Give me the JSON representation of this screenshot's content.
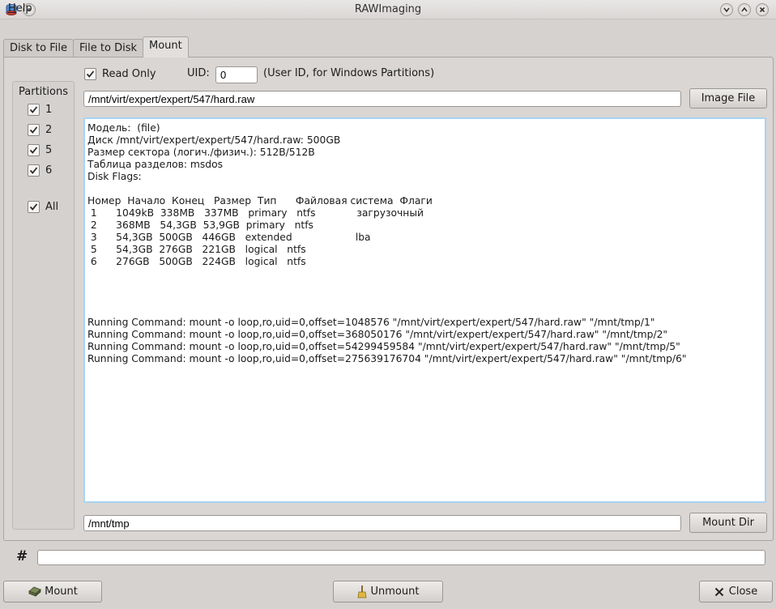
{
  "window": {
    "title": "RAWImaging"
  },
  "menu": {
    "help": "Help"
  },
  "tabs": [
    {
      "label": "Disk to File"
    },
    {
      "label": "File to Disk"
    },
    {
      "label": "Mount"
    }
  ],
  "mount": {
    "read_only_label": "Read Only",
    "read_only_checked": true,
    "uid_label": "UID:",
    "uid_value": "0",
    "uid_hint": "(User ID, for Windows Partitions)",
    "image_path": "/mnt/virt/expert/expert/547/hard.raw",
    "image_file_button": "Image File",
    "mount_dir": "/mnt/tmp",
    "mount_dir_button": "Mount Dir"
  },
  "partitions": {
    "title": "Partitions",
    "items": [
      {
        "label": "1",
        "checked": true
      },
      {
        "label": "2",
        "checked": true
      },
      {
        "label": "5",
        "checked": true
      },
      {
        "label": "6",
        "checked": true
      }
    ],
    "all": {
      "label": "All",
      "checked": true
    }
  },
  "output": {
    "text": "Модель:  (file)\nДиск /mnt/virt/expert/expert/547/hard.raw: 500GB\nРазмер сектора (логич./физич.): 512B/512B\nТаблица разделов: msdos\nDisk Flags:\n\nНомер  Начало  Конец   Размер  Тип      Файловая система  Флаги\n 1      1049kB  338MB   337MB   primary   ntfs             загрузочный\n 2      368MB   54,3GB  53,9GB  primary   ntfs\n 3      54,3GB  500GB   446GB   extended                    lba\n 5      54,3GB  276GB   221GB   logical   ntfs\n 6      276GB   500GB   224GB   logical   ntfs\n\n\n\n\nRunning Command: mount -o loop,ro,uid=0,offset=1048576 \"/mnt/virt/expert/expert/547/hard.raw\" \"/mnt/tmp/1\"\nRunning Command: mount -o loop,ro,uid=0,offset=368050176 \"/mnt/virt/expert/expert/547/hard.raw\" \"/mnt/tmp/2\"\nRunning Command: mount -o loop,ro,uid=0,offset=54299459584 \"/mnt/virt/expert/expert/547/hard.raw\" \"/mnt/tmp/5\"\nRunning Command: mount -o loop,ro,uid=0,offset=275639176704 \"/mnt/virt/expert/expert/547/hard.raw\" \"/mnt/tmp/6\""
  },
  "command": {
    "prompt": "#",
    "value": ""
  },
  "buttons": {
    "mount": "Mount",
    "unmount": "Unmount",
    "close": "Close"
  },
  "colors": {
    "focus_border": "#a8d4f2",
    "window_bg": "#d6d2d0"
  }
}
